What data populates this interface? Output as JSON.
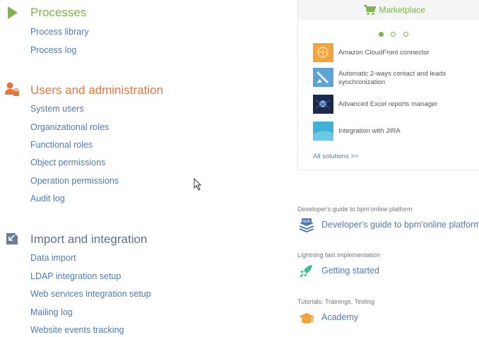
{
  "processes": {
    "title": "Processes",
    "icon": "play-icon",
    "links": [
      "Process library",
      "Process log"
    ]
  },
  "users": {
    "title": "Users and administration",
    "icon": "user-lock-icon",
    "links": [
      "System users",
      "Organizational roles",
      "Functional roles",
      "Object permissions",
      "Operation permissions",
      "Audit log"
    ]
  },
  "import": {
    "title": "Import and integration",
    "icon": "import-icon",
    "links": [
      "Data import",
      "LDAP integration setup",
      "Web services integration setup",
      "Mailing log",
      "Website events tracking"
    ]
  },
  "marketplace": {
    "title": "Marketplace",
    "icon": "cart-icon",
    "items": [
      {
        "label": "Amazon CloudFront connector",
        "thumb": "amazon-thumb"
      },
      {
        "label": "Automatic 2-ways contact and leads synchronization",
        "thumb": "sync-thumb"
      },
      {
        "label": "Advanced Excel reports manager",
        "thumb": "excel-thumb"
      },
      {
        "label": "Integration with JIRA",
        "thumb": "jira-thumb"
      }
    ],
    "all_solutions": "All solutions >>",
    "carousel": {
      "pages": 3,
      "active": 1
    }
  },
  "resources": [
    {
      "caption": "Developer's guide to bpm'online platform",
      "link": "Developer's guide to bpm'online platform",
      "icon": "sdk-icon"
    },
    {
      "caption": "Lightning fast implementation",
      "link": "Getting started",
      "icon": "rocket-icon"
    },
    {
      "caption": "Tutorials. Trainings. Testing",
      "link": "Academy",
      "icon": "graduation-cap-icon"
    }
  ],
  "colors": {
    "green": "#7ab648",
    "orange": "#e5763f",
    "slate": "#5f7186",
    "link": "#4f7ab6"
  }
}
